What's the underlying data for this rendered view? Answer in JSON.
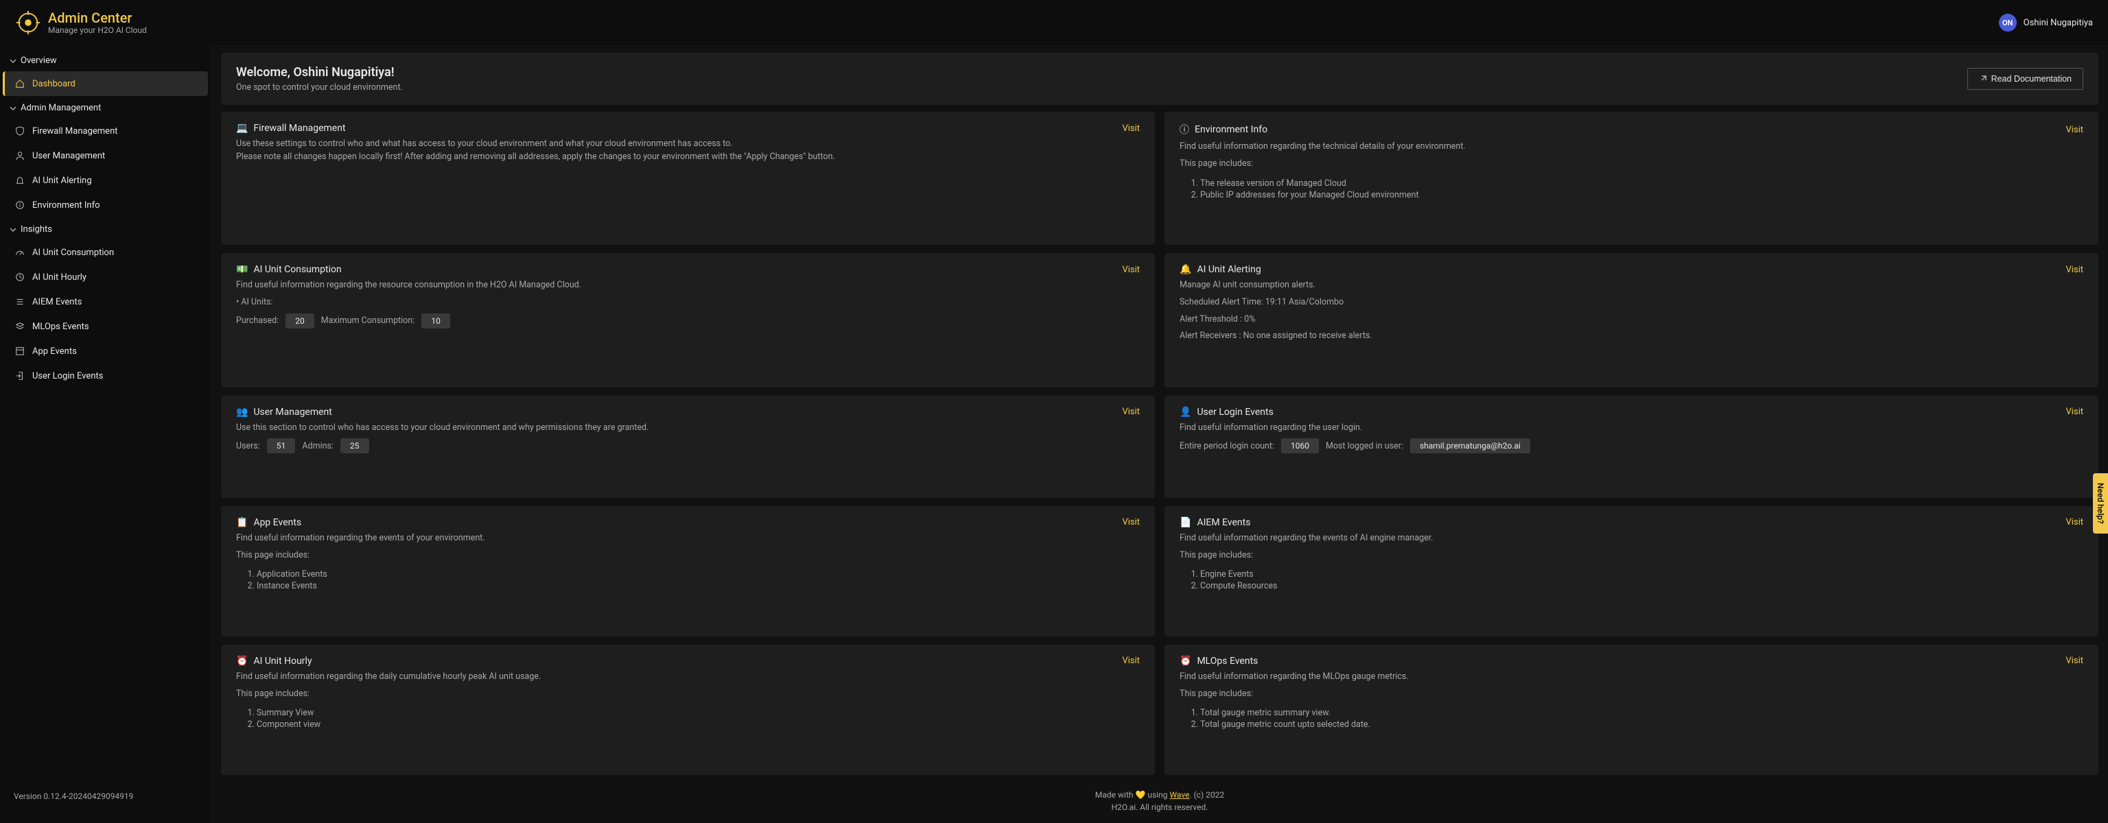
{
  "brand": {
    "title": "Admin Center",
    "subtitle": "Manage your H2O AI Cloud"
  },
  "user": {
    "initials": "ON",
    "name": "Oshini Nugapitiya"
  },
  "nav": {
    "sections": [
      {
        "label": "Overview",
        "items": [
          {
            "label": "Dashboard",
            "icon": "home",
            "active": true
          }
        ]
      },
      {
        "label": "Admin Management",
        "items": [
          {
            "label": "Firewall Management",
            "icon": "shield"
          },
          {
            "label": "User Management",
            "icon": "user"
          },
          {
            "label": "AI Unit Alerting",
            "icon": "bell"
          },
          {
            "label": "Environment Info",
            "icon": "info"
          }
        ]
      },
      {
        "label": "Insights",
        "items": [
          {
            "label": "AI Unit Consumption",
            "icon": "gauge"
          },
          {
            "label": "AI Unit Hourly",
            "icon": "clock"
          },
          {
            "label": "AIEM Events",
            "icon": "list"
          },
          {
            "label": "MLOps Events",
            "icon": "stack"
          },
          {
            "label": "App Events",
            "icon": "layout"
          },
          {
            "label": "User Login Events",
            "icon": "login"
          }
        ]
      }
    ]
  },
  "version": "Version 0.12.4-20240429094919",
  "hero": {
    "welcome": "Welcome, Oshini Nugapitiya!",
    "subtitle": "One spot to control your cloud environment.",
    "doc_button": "Read Documentation"
  },
  "cards": {
    "firewall": {
      "icon": "💻",
      "title": "Firewall Management",
      "desc": "Use these settings to control who and what has access to your cloud environment and what your cloud environment has access to.\nPlease note all changes happen locally first! After adding and removing all addresses, apply the changes to your environment with the \"Apply Changes\" button.",
      "visit": "Visit"
    },
    "env": {
      "icon": "ⓘ",
      "title": "Environment Info",
      "desc": "Find useful information regarding the technical details of your environment.",
      "includes": "This page includes:",
      "items": [
        "The release version of Managed Cloud",
        "Public IP addresses for your Managed Cloud environment"
      ],
      "visit": "Visit"
    },
    "consumption": {
      "icon": "💵",
      "title": "AI Unit Consumption",
      "desc": "Find useful information regarding the resource consumption in the H2O AI Managed Cloud.",
      "bullet": "• AI Units:",
      "purchased_label": "Purchased:",
      "purchased": "20",
      "max_label": "Maximum Consumption:",
      "max": "10",
      "visit": "Visit"
    },
    "alerting": {
      "icon": "🔔",
      "title": "AI Unit Alerting",
      "line1": "Manage AI unit consumption alerts.",
      "line2": "Scheduled Alert Time: 19:11 Asia/Colombo",
      "line3": "Alert Threshold : 0%",
      "line4": "Alert Receivers : No one assigned to receive alerts.",
      "visit": "Visit"
    },
    "usermgmt": {
      "icon": "👥",
      "title": "User Management",
      "desc": "Use this section to control who has access to your cloud environment and why permissions they are granted.",
      "users_label": "Users:",
      "users": "51",
      "admins_label": "Admins:",
      "admins": "25",
      "visit": "Visit"
    },
    "loginevents": {
      "icon": "👤",
      "title": "User Login Events",
      "desc": "Find useful information regarding the user login.",
      "count_label": "Entire period login count:",
      "count": "1060",
      "most_label": "Most logged in user:",
      "most": "shamil.prematunga@h2o.ai",
      "visit": "Visit"
    },
    "appevents": {
      "icon": "📋",
      "title": "App Events",
      "desc": "Find useful information regarding the events of your environment.",
      "includes": "This page includes:",
      "items": [
        "Application Events",
        "Instance Events"
      ],
      "visit": "Visit"
    },
    "aiem": {
      "icon": "📄",
      "title": "AIEM Events",
      "desc": "Find useful information regarding the events of AI engine manager.",
      "includes": "This page includes:",
      "items": [
        "Engine Events",
        "Compute Resources"
      ],
      "visit": "Visit"
    },
    "hourly": {
      "icon": "⏰",
      "title": "AI Unit Hourly",
      "desc": "Find useful information regarding the daily cumulative hourly peak AI unit usage.",
      "includes": "This page includes:",
      "items": [
        "Summary View",
        "Component view"
      ],
      "visit": "Visit"
    },
    "mlops": {
      "icon": "⏰",
      "title": "MLOps Events",
      "desc": "Find useful information regarding the MLOps gauge metrics.",
      "includes": "This page includes:",
      "items": [
        "Total gauge metric summary view.",
        "Total gauge metric count upto selected date."
      ],
      "visit": "Visit"
    }
  },
  "footer": {
    "line1a": "Made with 💛 using ",
    "wave": "Wave",
    "line1b": ". (c) 2022",
    "line2": "H2O.ai. All rights reserved."
  },
  "help": "Need help?"
}
